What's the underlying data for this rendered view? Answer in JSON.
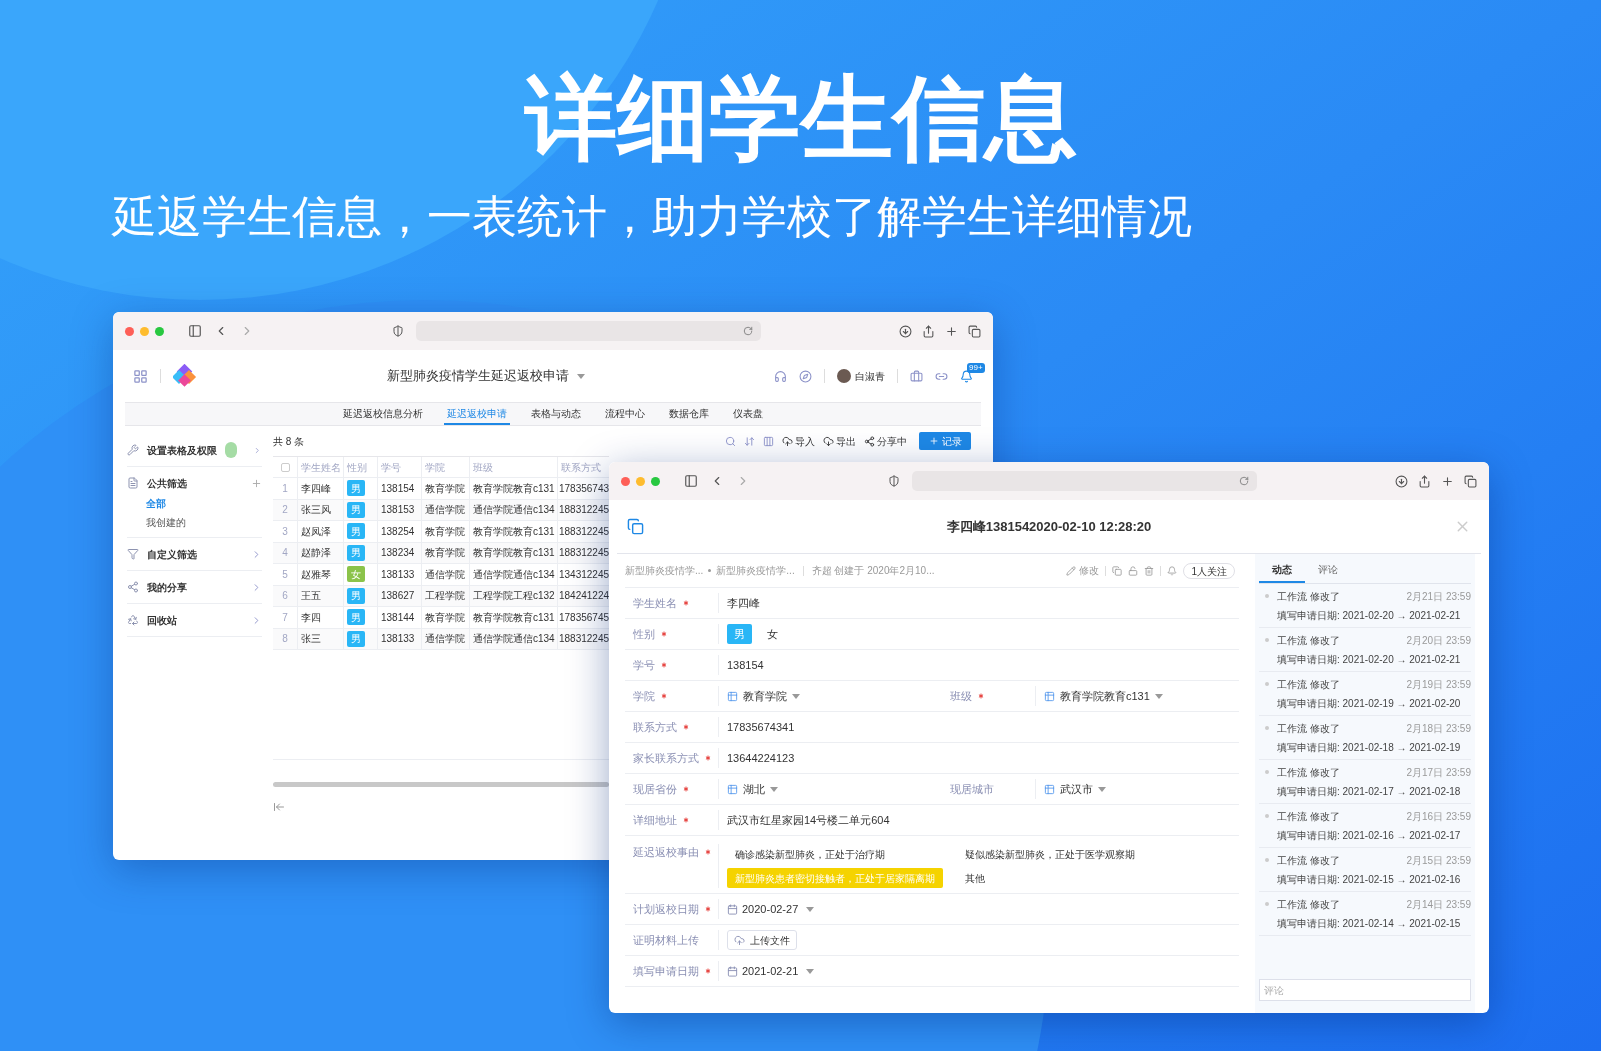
{
  "headline": {
    "title": "详细学生信息",
    "subtitle": "延返学生信息，一表统计，助力学校了解学生详细情况"
  },
  "list_window": {
    "app_title": "新型肺炎疫情学生延迟返校申请",
    "user_name": "白淑青",
    "notification_badge": "99+",
    "tabs": [
      {
        "label": "延迟返校信息分析",
        "selected": false
      },
      {
        "label": "延迟返校申请",
        "selected": true
      },
      {
        "label": "表格与动态",
        "selected": false
      },
      {
        "label": "流程中心",
        "selected": false
      },
      {
        "label": "数据仓库",
        "selected": false
      },
      {
        "label": "仪表盘",
        "selected": false
      }
    ],
    "sidebar": [
      {
        "kind": "settings",
        "label": "设置表格及权限"
      },
      {
        "kind": "group",
        "label": "公共筛选",
        "children": [
          {
            "label": "全部",
            "selected": true
          },
          {
            "label": "我创建的",
            "selected": false
          }
        ]
      },
      {
        "kind": "filter",
        "label": "自定义筛选"
      },
      {
        "kind": "share",
        "label": "我的分享"
      },
      {
        "kind": "trash",
        "label": "回收站"
      }
    ],
    "record_count": "共 8 条",
    "toolbar": [
      {
        "kind": "import",
        "label": "导入"
      },
      {
        "kind": "export",
        "label": "导出"
      },
      {
        "kind": "share",
        "label": "分享中"
      }
    ],
    "add_button": "记录",
    "table": {
      "select_all_checked": false,
      "columns": [
        "学生姓名",
        "性别",
        "学号",
        "学院",
        "班级",
        "联系方式"
      ],
      "rows": [
        {
          "index": "1",
          "name": "李四峰",
          "gender": "男",
          "color": "#29b6f6",
          "student_id": "138154",
          "college": "教育学院",
          "class": "教育学院教育c131",
          "phone": "178356743"
        },
        {
          "index": "2",
          "name": "张三风",
          "gender": "男",
          "color": "#29b6f6",
          "student_id": "138153",
          "college": "通信学院",
          "class": "通信学院通信c134",
          "phone": "188312245"
        },
        {
          "index": "3",
          "name": "赵凤泽",
          "gender": "男",
          "color": "#29b6f6",
          "student_id": "138254",
          "college": "教育学院",
          "class": "教育学院教育c131",
          "phone": "188312245"
        },
        {
          "index": "4",
          "name": "赵静泽",
          "gender": "男",
          "color": "#29b6f6",
          "student_id": "138234",
          "college": "教育学院",
          "class": "教育学院教育c131",
          "phone": "188312245"
        },
        {
          "index": "5",
          "name": "赵雅琴",
          "gender": "女",
          "color": "#8bc34a",
          "student_id": "138133",
          "college": "通信学院",
          "class": "通信学院通信c134",
          "phone": "134312245"
        },
        {
          "index": "6",
          "name": "王五",
          "gender": "男",
          "color": "#29b6f6",
          "student_id": "138627",
          "college": "工程学院",
          "class": "工程学院工程c132",
          "phone": "184241224"
        },
        {
          "index": "7",
          "name": "李四",
          "gender": "男",
          "color": "#29b6f6",
          "student_id": "138144",
          "college": "教育学院",
          "class": "教育学院教育c131",
          "phone": "178356745"
        },
        {
          "index": "8",
          "name": "张三",
          "gender": "男",
          "color": "#29b6f6",
          "student_id": "138133",
          "college": "通信学院",
          "class": "通信学院通信c134",
          "phone": "188312245"
        }
      ]
    }
  },
  "detail_window": {
    "title": "李四峰1381542020-02-10 12:28:20",
    "breadcrumb": [
      "新型肺炎疫情学...",
      "新型肺炎疫情学..."
    ],
    "creator": "齐超 创建于 2020年2月10...",
    "edit": "修改",
    "follow": "1人关注",
    "fields": [
      {
        "kind": "text",
        "label": "学生姓名",
        "required": true,
        "value": "李四峰"
      },
      {
        "kind": "choice",
        "label": "性别",
        "required": true,
        "options": [
          {
            "label": "男",
            "selected": true
          },
          {
            "label": "女",
            "selected": false
          }
        ]
      },
      {
        "kind": "text",
        "label": "学号",
        "required": true,
        "value": "138154"
      },
      {
        "kind": "select_pair",
        "items": [
          {
            "label": "学院",
            "required": true,
            "value": "教育学院"
          },
          {
            "label": "班级",
            "required": true,
            "value": "教育学院教育c131"
          }
        ]
      },
      {
        "kind": "text",
        "label": "联系方式",
        "required": true,
        "value": "17835674341"
      },
      {
        "kind": "text",
        "label": "家长联系方式",
        "required": true,
        "value": "13644224123"
      },
      {
        "kind": "select_pair",
        "items": [
          {
            "label": "现居省份",
            "required": true,
            "value": "湖北"
          },
          {
            "label": "现居城市",
            "required": false,
            "value": "武汉市"
          }
        ]
      },
      {
        "kind": "text",
        "label": "详细地址",
        "required": true,
        "value": "武汉市红星家园14号楼二单元604"
      },
      {
        "kind": "multi_choice",
        "label": "延迟返校事由",
        "required": true,
        "options": [
          {
            "label": "确诊感染新型肺炎，正处于治疗期",
            "selected": false
          },
          {
            "label": "疑似感染新型肺炎，正处于医学观察期",
            "selected": false
          },
          {
            "label": "新型肺炎患者密切接触者，正处于居家隔离期",
            "selected": true
          },
          {
            "label": "其他",
            "selected": false
          }
        ]
      },
      {
        "kind": "date",
        "label": "计划返校日期",
        "required": true,
        "value": "2020-02-27"
      },
      {
        "kind": "upload",
        "label": "证明材料上传",
        "required": false,
        "button": "上传文件"
      },
      {
        "kind": "date",
        "label": "填写申请日期",
        "required": true,
        "value": "2021-02-21"
      }
    ],
    "side_tabs": [
      {
        "label": "动态",
        "selected": true
      },
      {
        "label": "评论",
        "selected": false
      }
    ],
    "activity": [
      {
        "actor": "工作流 修改了",
        "time": "2月21日 23:59",
        "change": "填写申请日期: 2021-02-20 → 2021-02-21"
      },
      {
        "actor": "工作流 修改了",
        "time": "2月20日 23:59",
        "change": "填写申请日期: 2021-02-20 → 2021-02-21"
      },
      {
        "actor": "工作流 修改了",
        "time": "2月19日 23:59",
        "change": "填写申请日期: 2021-02-19 → 2021-02-20"
      },
      {
        "actor": "工作流 修改了",
        "time": "2月18日 23:59",
        "change": "填写申请日期: 2021-02-18 → 2021-02-19"
      },
      {
        "actor": "工作流 修改了",
        "time": "2月17日 23:59",
        "change": "填写申请日期: 2021-02-17 → 2021-02-18"
      },
      {
        "actor": "工作流 修改了",
        "time": "2月16日 23:59",
        "change": "填写申请日期: 2021-02-16 → 2021-02-17"
      },
      {
        "actor": "工作流 修改了",
        "time": "2月15日 23:59",
        "change": "填写申请日期: 2021-02-15 → 2021-02-16"
      },
      {
        "actor": "工作流 修改了",
        "time": "2月14日 23:59",
        "change": "填写申请日期: 2021-02-14 → 2021-02-15"
      }
    ],
    "comment_placeholder": "评论"
  }
}
